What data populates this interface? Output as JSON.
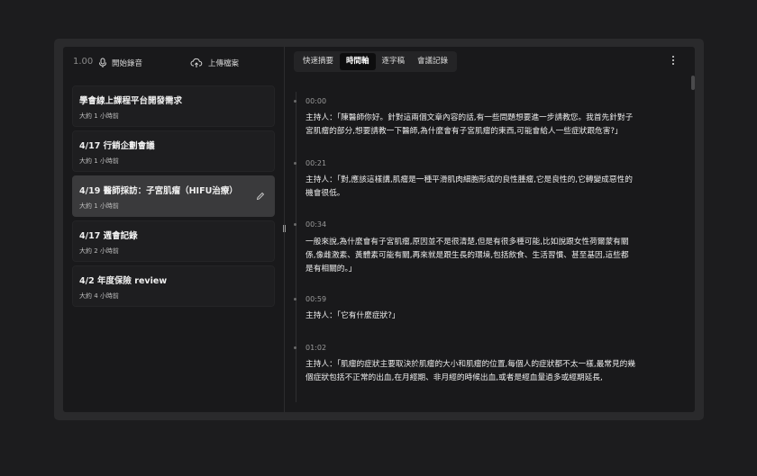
{
  "toolbar": {
    "counter": "1.00",
    "record_label": "開始錄音",
    "upload_label": "上傳檔案",
    "record_icon": "microphone-icon",
    "upload_icon": "cloud-upload-icon"
  },
  "recordings": [
    {
      "title": "學會線上課程平台開發需求",
      "time": "大約 1 小時前"
    },
    {
      "title": "4/17 行銷企劃會議",
      "time": "大約 1 小時前"
    },
    {
      "title": "4/19 醫師採訪：子宮肌瘤（HIFU治療）",
      "time": "大約 1 小時前"
    },
    {
      "title": "4/17 週會記錄",
      "time": "大約 2 小時前"
    },
    {
      "title": "4/2 年度保險 review",
      "time": "大約 4 小時前"
    }
  ],
  "tabs": [
    {
      "label": "快速摘要"
    },
    {
      "label": "時間軸"
    },
    {
      "label": "逐字稿"
    },
    {
      "label": "會議記錄"
    }
  ],
  "active_tab": "時間軸",
  "transcript": [
    {
      "time": "00:00",
      "lines": [
        "主持人：「陳醫師你好。針對這兩個文章內容的話,有一些問題想要進一步請教您。我首先針對子",
        "宮肌瘤的部分,想要請教一下醫師,為什麼會有子宮肌瘤的東西,可能會給人一些症狀跟危害?」"
      ]
    },
    {
      "time": "00:21",
      "lines": [
        "主持人：「對,應該這樣講,肌瘤是一種平滑肌肉細胞形成的良性腫瘤,它是良性的,它轉變成惡性的",
        "機會很低。"
      ]
    },
    {
      "time": "00:34",
      "lines": [
        "一般來說,為什麼會有子宮肌瘤,原因並不是很清楚,但是有很多種可能,比如說跟女性荷爾蒙有關",
        "係,像雌激素、黃體素可能有關,再來就是跟生長的環境,包括飲食、生活習慣、甚至基因,這些都",
        "是有相關的。」"
      ]
    },
    {
      "time": "00:59",
      "lines": [
        "主持人：「它有什麼症狀?」"
      ]
    },
    {
      "time": "01:02",
      "lines": [
        "主持人：「肌瘤的症狀主要取決於肌瘤的大小和肌瘤的位置,每個人的症狀都不太一樣,最常見的幾",
        "個症狀包括不正常的出血,在月經期、非月經的時候出血,或者是經血量過多或經期延長,"
      ]
    }
  ],
  "colors": {
    "background": "#1c1c1e",
    "window": "#2a2a2c",
    "active_item": "#3a3a3c",
    "active_tab": "#0d0d0e"
  }
}
